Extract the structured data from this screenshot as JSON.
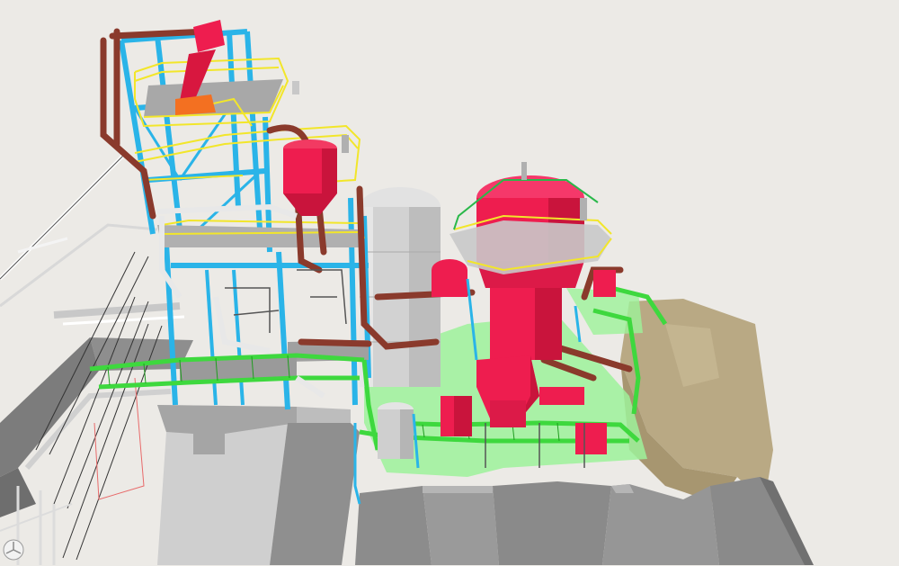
{
  "viewport": {
    "background": "#eceae6",
    "description_icon": "axis-orientation-icon"
  },
  "colors": {
    "structural_steel": "#2ab4e8",
    "handrail_yellow": "#f2e62a",
    "vessel_red": "#ee1d4f",
    "process_pipe_brown": "#8a3a2c",
    "grating_green": "#9ef29a",
    "cable_tray_green": "#3ed83e",
    "equipment_grey": "#c8c8c8",
    "concrete_grey": "#9a9a9a",
    "tarp_tan": "#b9a984"
  }
}
